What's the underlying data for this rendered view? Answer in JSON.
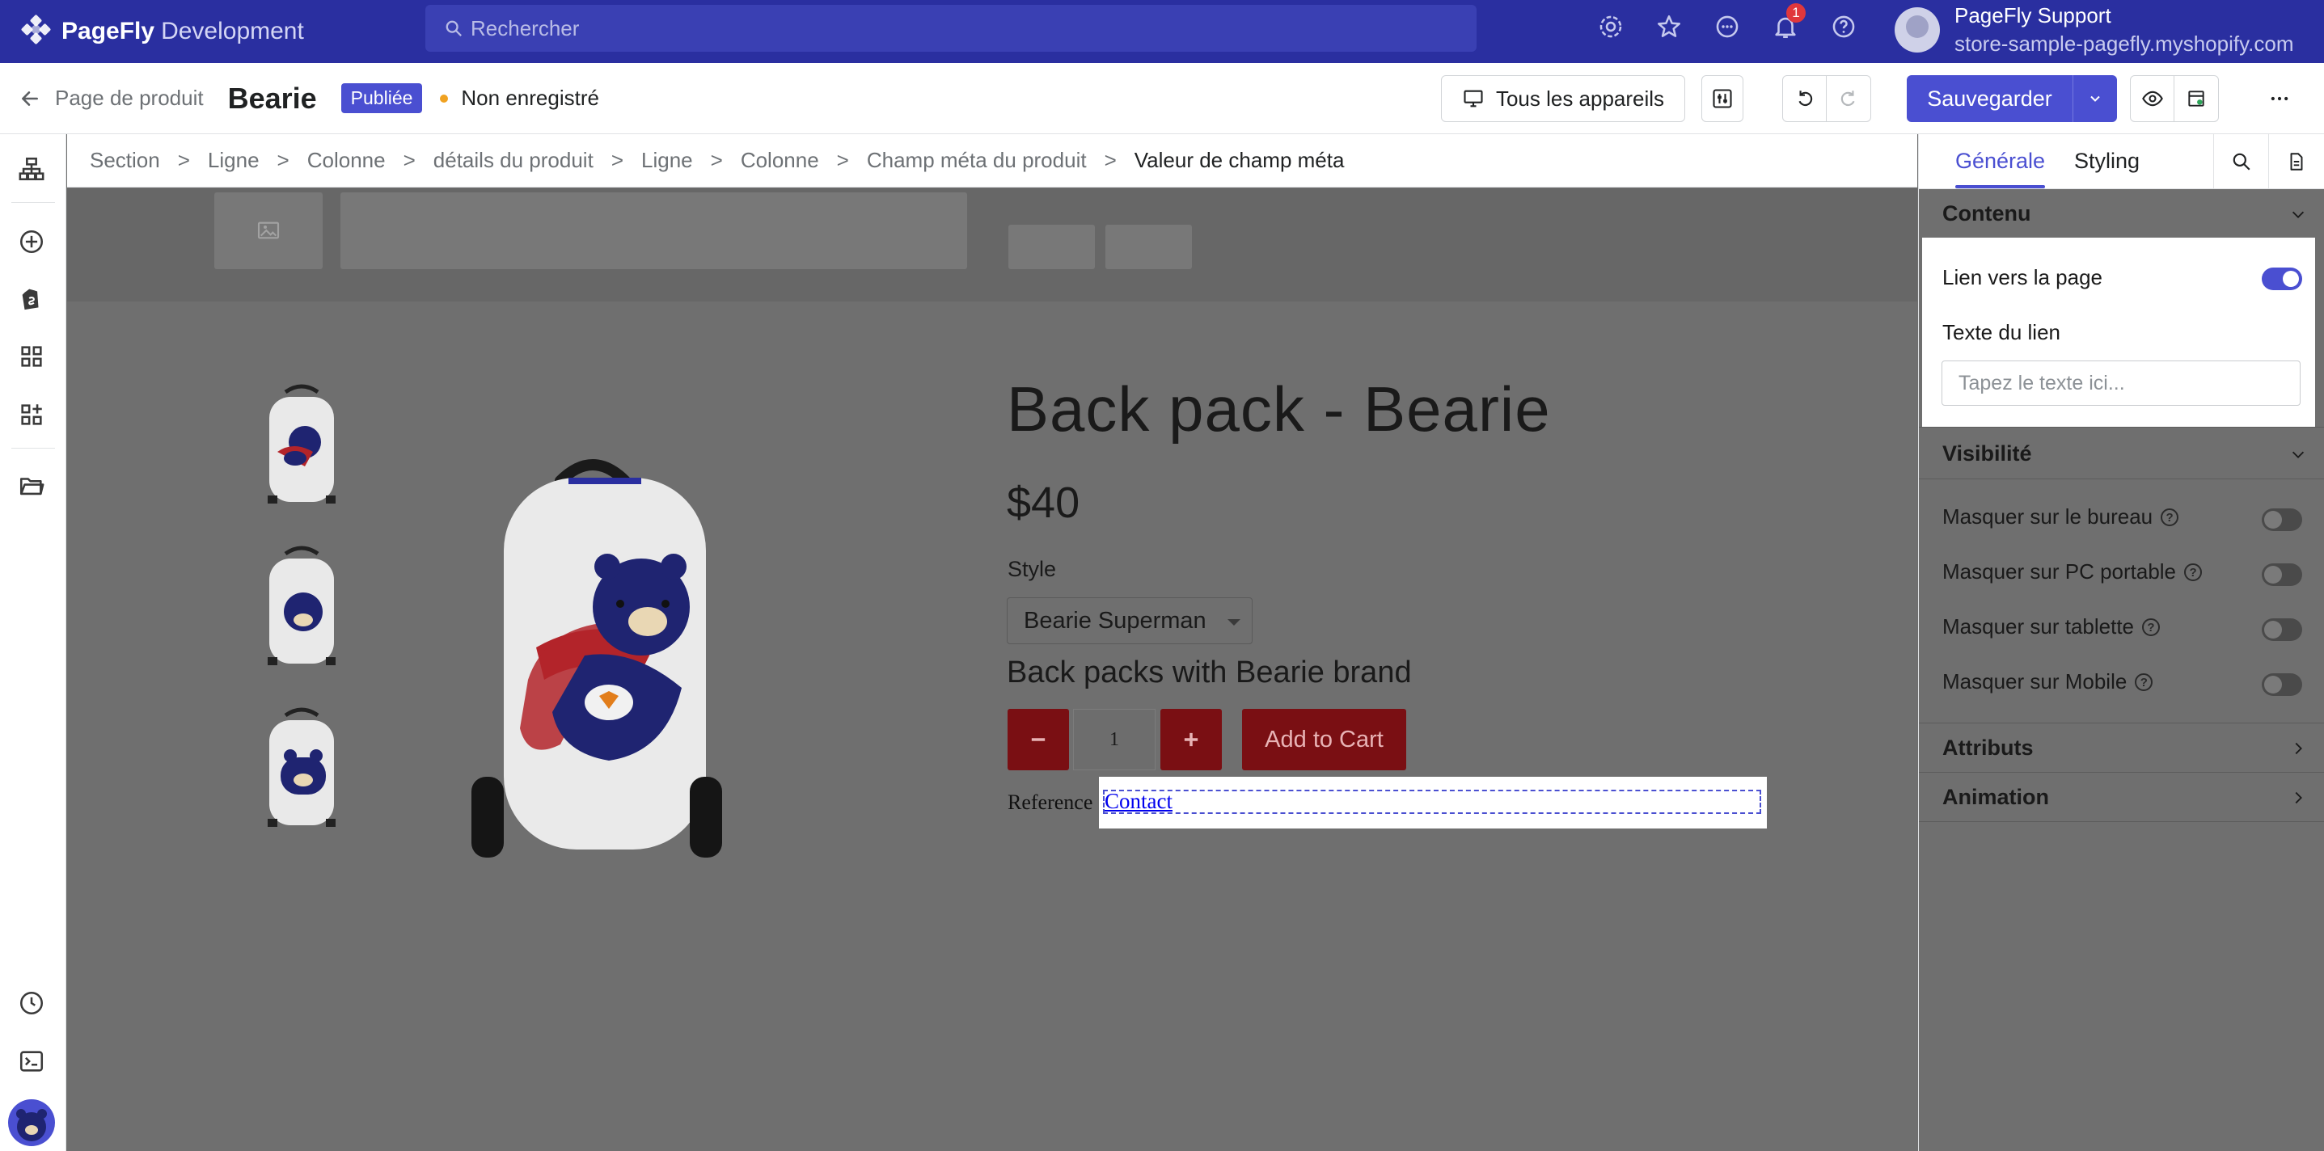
{
  "topbar": {
    "brand_name": "PageFly",
    "brand_env": "Development",
    "search_placeholder": "Rechercher",
    "notification_count": "1",
    "user_name": "PageFly Support",
    "user_store": "store-sample-pagefly.myshopify.com"
  },
  "header": {
    "back_label": "Page de produit",
    "page_title": "Bearie",
    "status_badge": "Publiée",
    "save_state": "Non enregistré",
    "devices_label": "Tous les appareils",
    "save_label": "Sauvegarder"
  },
  "breadcrumb": [
    "Section",
    "Ligne",
    "Colonne",
    "détails du produit",
    "Ligne",
    "Colonne",
    "Champ méta du produit",
    "Valeur de champ méta"
  ],
  "product": {
    "title": "Back pack - Bearie",
    "price": "$40",
    "style_label": "Style",
    "style_value": "Bearie Superman",
    "description": "Back packs with Bearie brand",
    "quantity": "1",
    "add_to_cart": "Add to Cart",
    "reference_label": "Reference",
    "reference_link": "Contact"
  },
  "panel": {
    "tabs": [
      "Générale",
      "Styling"
    ],
    "content_title": "Contenu",
    "link_to_page": "Lien vers la page",
    "link_text_label": "Texte du lien",
    "link_text_placeholder": "Tapez le texte ici...",
    "visibility_title": "Visibilité",
    "visibility_items": [
      "Masquer sur le bureau",
      "Masquer sur PC portable",
      "Masquer sur tablette",
      "Masquer sur Mobile"
    ],
    "attributes_title": "Attributs",
    "animation_title": "Animation"
  },
  "colors": {
    "brand": "#2a2fa0",
    "accent": "#4a4fd1",
    "cart_button": "#7a0f13"
  }
}
